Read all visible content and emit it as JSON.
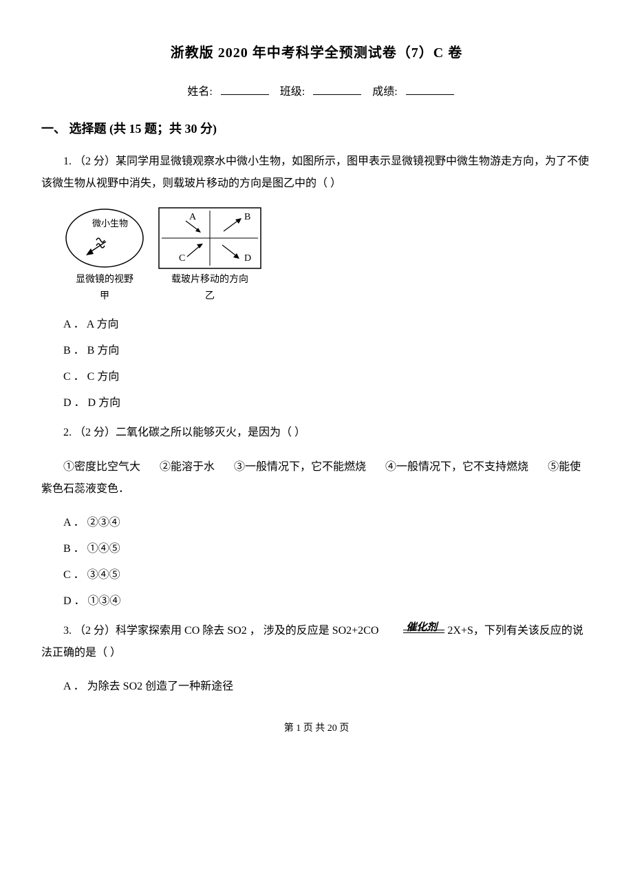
{
  "title": "浙教版 2020 年中考科学全预测试卷（7）C 卷",
  "info": {
    "name_label": "姓名:",
    "class_label": "班级:",
    "score_label": "成绩:"
  },
  "section1": {
    "header": "一、 选择题 (共 15 题；共 30 分)"
  },
  "q1": {
    "number": "1. ",
    "points": "（2 分）",
    "stem_a": "某同学用显微镜观察水中微小生物，如图所示，图甲表示显微镜视野中微生物游走方向，为了不使该微生物从视野中消失，则载玻片移动的方向是图乙中的（    ）",
    "fig1_caption_a": "显微镜的视野",
    "fig1_caption_b": "甲",
    "fig2_caption_a": "载玻片移动的方向",
    "fig2_caption_b": "乙",
    "fig1_label": "微小生物",
    "arrow_a": "A",
    "arrow_b": "B",
    "arrow_c": "C",
    "arrow_d": "D",
    "opt_a": "A ． A 方向",
    "opt_b": "B ． B 方向",
    "opt_c": "C ． C 方向",
    "opt_d": "D ． D 方向"
  },
  "q2": {
    "number": "2. ",
    "points": "（2 分）",
    "stem": "二氧化碳之所以能够灭火，是因为（    ）",
    "s1": "①密度比空气大",
    "s2": "②能溶于水",
    "s3": "③一般情况下，它不能燃烧",
    "s4": "④一般情况下，它不支持燃烧",
    "s5": "⑤能使紫色石蕊液变色．",
    "opt_a": "A ． ②③④",
    "opt_b": "B ． ①④⑤",
    "opt_c": "C ． ③④⑤",
    "opt_d": "D ． ①③④"
  },
  "q3": {
    "number": "3. ",
    "points": "（2 分）",
    "stem_a": "科学家探索用 CO 除去 SO2 ， 涉及的反应是 SO2+2CO ",
    "catalyst": "催化剂",
    "stem_b": " 2X+S，下列有关该反应的说法正确的是（    ）",
    "opt_a": "A ． 为除去 SO2 创造了一种新途径"
  },
  "footer": "第 1 页 共 20 页"
}
